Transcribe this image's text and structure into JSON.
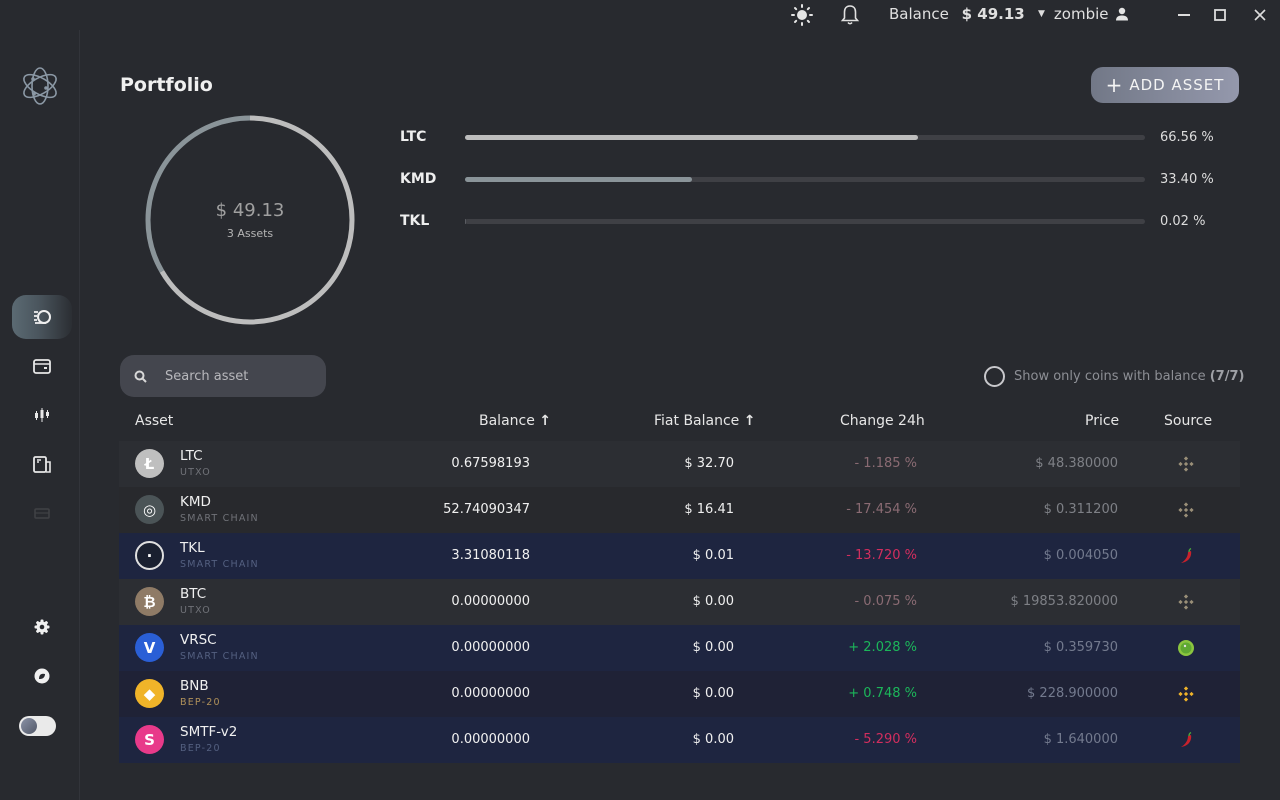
{
  "topbar": {
    "theme_icon": "sun-icon",
    "notifications_icon": "bell-icon",
    "balance_label": "Balance",
    "balance_value": "$ 49.13",
    "username": "zombie",
    "user_icon": "user-icon",
    "window_controls": [
      "minimize",
      "maximize",
      "close"
    ]
  },
  "sidebar": {
    "logo": "atom-logo-icon",
    "items": [
      {
        "name": "portfolio",
        "icon": "portfolio-coins-icon",
        "active": true
      },
      {
        "name": "wallet",
        "icon": "wallet-icon",
        "active": false
      },
      {
        "name": "dex",
        "icon": "candlestick-icon",
        "active": false
      },
      {
        "name": "addressbook",
        "icon": "addressbook-icon",
        "active": false
      },
      {
        "name": "fiat",
        "icon": "card-icon",
        "active": false
      }
    ],
    "bottom": [
      {
        "name": "settings",
        "icon": "gear-icon"
      },
      {
        "name": "support",
        "icon": "support-icon"
      }
    ],
    "theme_toggle_on": true
  },
  "portfolio": {
    "title": "Portfolio",
    "add_asset_label": "ADD ASSET",
    "total_value": "$ 49.13",
    "asset_count": "3 Assets",
    "distribution": [
      {
        "ticker": "LTC",
        "percent": 66.56,
        "label": "66.56 %",
        "color": "#bdbdbd"
      },
      {
        "ticker": "KMD",
        "percent": 33.4,
        "label": "33.40 %",
        "color": "#8a9499"
      },
      {
        "ticker": "TKL",
        "percent": 0.02,
        "label": "0.02 %",
        "color": "#5a5c62"
      }
    ]
  },
  "search": {
    "placeholder": "Search asset",
    "value": ""
  },
  "filter": {
    "label": "Show only coins with balance",
    "count": "(7/7)",
    "checked": false
  },
  "table": {
    "headers": {
      "asset": "Asset",
      "balance": "Balance",
      "fiat_balance": "Fiat Balance",
      "change": "Change 24h",
      "price": "Price",
      "source": "Source"
    },
    "sort_icon": "arrow-up-icon",
    "rows": [
      {
        "ticker": "LTC",
        "type": "UTXO",
        "balance": "0.67598193",
        "fiat": "$ 32.70",
        "change": "- 1.185 %",
        "change_dir": "neg-muted",
        "price": "$ 48.380000",
        "source": "binance",
        "icon_color": "#bfbfbf",
        "icon_glyph": "Ł"
      },
      {
        "ticker": "KMD",
        "type": "SMART CHAIN",
        "balance": "52.74090347",
        "fiat": "$ 16.41",
        "change": "- 17.454 %",
        "change_dir": "neg-muted",
        "price": "$ 0.311200",
        "source": "binance",
        "icon_color": "#4b5457",
        "icon_glyph": "◎"
      },
      {
        "ticker": "TKL",
        "type": "SMART CHAIN",
        "balance": "3.31080118",
        "fiat": "$ 0.01",
        "change": "- 13.720 %",
        "change_dir": "neg",
        "price": "$ 0.004050",
        "source": "coinpaprika",
        "icon_color": "#1a2030",
        "icon_glyph": "·"
      },
      {
        "ticker": "BTC",
        "type": "UTXO",
        "balance": "0.00000000",
        "fiat": "$ 0.00",
        "change": "- 0.075 %",
        "change_dir": "neg-muted",
        "price": "$ 19853.820000",
        "source": "binance",
        "icon_color": "#8f7b66",
        "icon_glyph": "₿"
      },
      {
        "ticker": "VRSC",
        "type": "SMART CHAIN",
        "balance": "0.00000000",
        "fiat": "$ 0.00",
        "change": "+ 2.028 %",
        "change_dir": "pos",
        "price": "$ 0.359730",
        "source": "coingecko",
        "icon_color": "#2a5fd6",
        "icon_glyph": "V"
      },
      {
        "ticker": "BNB",
        "type": "BEP-20",
        "balance": "0.00000000",
        "fiat": "$ 0.00",
        "change": "+ 0.748 %",
        "change_dir": "pos",
        "price": "$ 228.900000",
        "source": "binance",
        "icon_color": "#f0b429",
        "icon_glyph": "◆"
      },
      {
        "ticker": "SMTF-v2",
        "type": "BEP-20",
        "balance": "0.00000000",
        "fiat": "$ 0.00",
        "change": "- 5.290 %",
        "change_dir": "neg",
        "price": "$ 1.640000",
        "source": "coinpaprika",
        "icon_color": "#e83a8a",
        "icon_glyph": "S"
      }
    ]
  }
}
